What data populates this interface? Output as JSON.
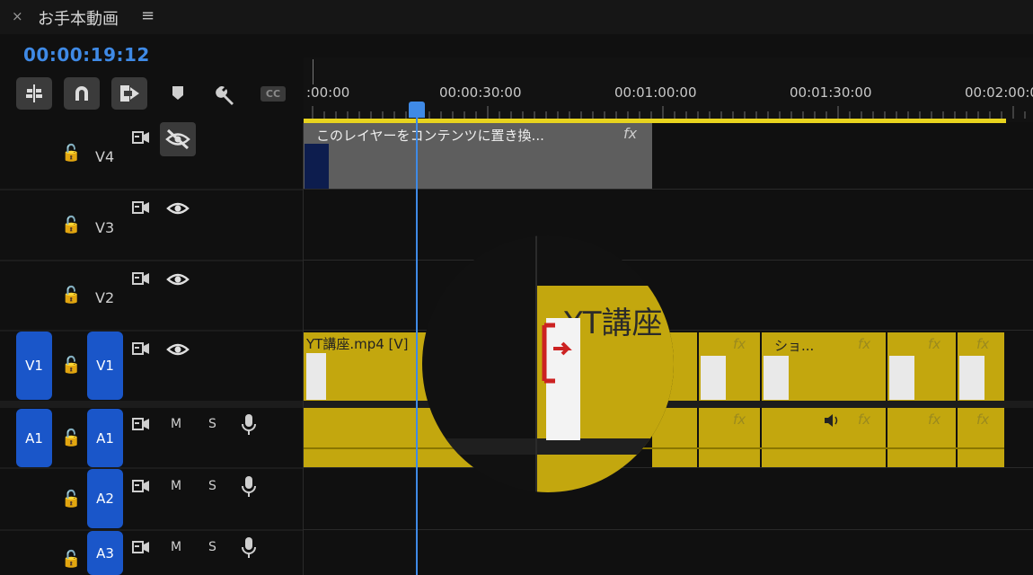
{
  "app": {
    "close_glyph": "×",
    "sequence_title": "お手本動画",
    "menu_glyph": "≡",
    "timecode": "00:00:19:12"
  },
  "toolbar": {
    "tools": [
      "insert-nested-icon",
      "snap-magnet-icon",
      "linked-selection-icon",
      "add-marker-icon",
      "wrench-settings-icon",
      "captions-icon"
    ],
    "captions_label": "CC"
  },
  "ruler": {
    "labels": [
      ":00:00",
      "00:00:30:00",
      "00:01:00:00",
      "00:01:30:00",
      "00:02:00:00"
    ]
  },
  "tracks": {
    "video": [
      {
        "label": "V4",
        "eye": "hidden"
      },
      {
        "label": "V3",
        "eye": "visible"
      },
      {
        "label": "V2",
        "eye": "visible"
      },
      {
        "label": "V1",
        "source_patch": "V1",
        "eye": "visible"
      }
    ],
    "audio": [
      {
        "label": "A1",
        "source_patch": "A1",
        "mute": "M",
        "solo": "S"
      },
      {
        "label": "A2",
        "mute": "M",
        "solo": "S"
      },
      {
        "label": "A3",
        "mute": "M",
        "solo": "S"
      }
    ]
  },
  "clips": {
    "graphic": {
      "label": "このレイヤーをコンテンツに置き換...",
      "fx": "fx"
    },
    "v1_main": {
      "label": "YT講座.mp4 [V]"
    },
    "v1_short": {
      "label": "ショ..."
    },
    "fx_label": "fx"
  },
  "magnifier": {
    "zoom_text": "YT講座"
  },
  "colors": {
    "accent_blue": "#3f8ae6",
    "clip_gold": "#c3a70e",
    "workarea_yellow": "#e7d31e",
    "track_blue": "#1a56c9"
  }
}
